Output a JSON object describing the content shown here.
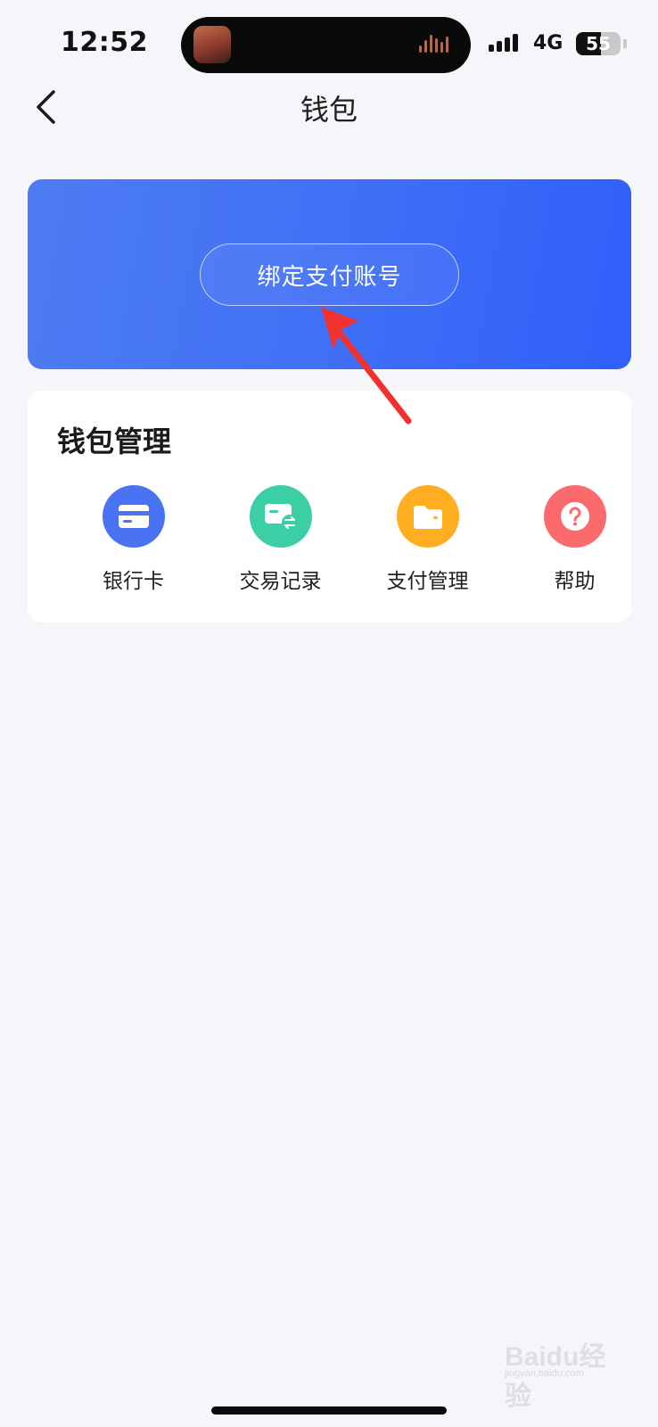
{
  "status_bar": {
    "time": "12:52",
    "network": "4G",
    "battery_percent": "55",
    "battery_level": 0.55
  },
  "nav": {
    "title": "钱包",
    "back_icon": "chevron-left-icon"
  },
  "banner": {
    "bind_button_label": "绑定支付账号",
    "gradient_colors": [
      "#4d7cf2",
      "#2f5ff9"
    ]
  },
  "wallet_management": {
    "title": "钱包管理",
    "items": [
      {
        "label": "银行卡",
        "icon": "bank-card-icon",
        "color": "#4a73f3"
      },
      {
        "label": "交易记录",
        "icon": "transaction-record-icon",
        "color": "#3ccfa6"
      },
      {
        "label": "支付管理",
        "icon": "folder-icon",
        "color": "#ffad21"
      },
      {
        "label": "帮助",
        "icon": "help-icon",
        "color": "#fb6a6c"
      }
    ]
  },
  "annotation": {
    "arrow_color": "#f0312f"
  },
  "watermark": {
    "brand": "Baidu经验",
    "url": "jingyan.baidu.com"
  }
}
